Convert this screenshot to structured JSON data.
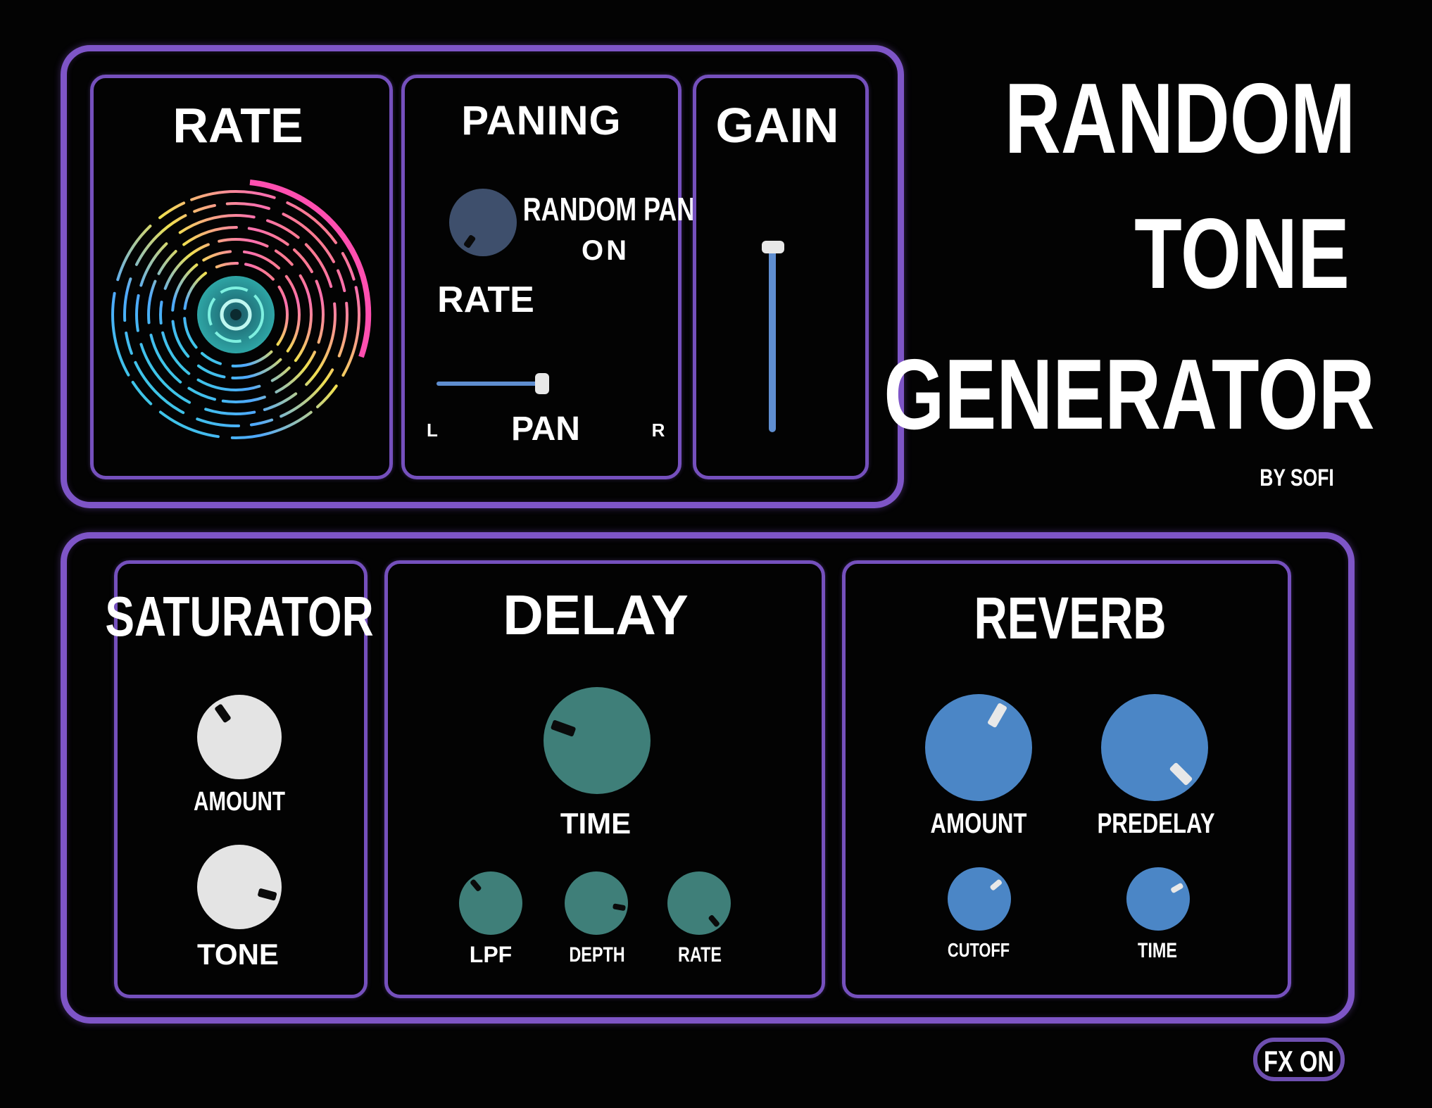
{
  "title": {
    "line1": "RANDOM",
    "line2": "TONE",
    "line3": "GENERATOR",
    "byline": "BY SOFI"
  },
  "panels": {
    "rate": {
      "title": "RATE",
      "visualizer_icon": "circular-spectrum-visualizer"
    },
    "paning": {
      "title": "PANING",
      "rate_label": "RATE",
      "random_pan_label": "RANDOM PAN",
      "random_pan_state": "ON",
      "pan_label": "PAN",
      "left_label": "L",
      "right_label": "R",
      "pan_value": 1.0,
      "rate_knob_value": 0.05
    },
    "gain": {
      "title": "GAIN",
      "value": 0.97
    },
    "saturator": {
      "title": "SATURATOR",
      "amount_label": "AMOUNT",
      "tone_label": "TONE"
    },
    "delay": {
      "title": "DELAY",
      "time_label": "TIME",
      "lpf_label": "LPF",
      "depth_label": "DEPTH",
      "rate_label": "RATE"
    },
    "reverb": {
      "title": "REVERB",
      "amount_label": "AMOUNT",
      "predelay_label": "PREDELAY",
      "cutoff_label": "CUTOFF",
      "time_label": "TIME"
    }
  },
  "fx_button": {
    "label": "FX ON"
  },
  "colors": {
    "border": "#7e55c7",
    "saturator_knob": "#e4e4e4",
    "delay_knob": "#3f7f79",
    "reverb_knob": "#4b86c6",
    "paning_knob": "#3e4f6c",
    "slider_track": "#5f8ed0"
  }
}
